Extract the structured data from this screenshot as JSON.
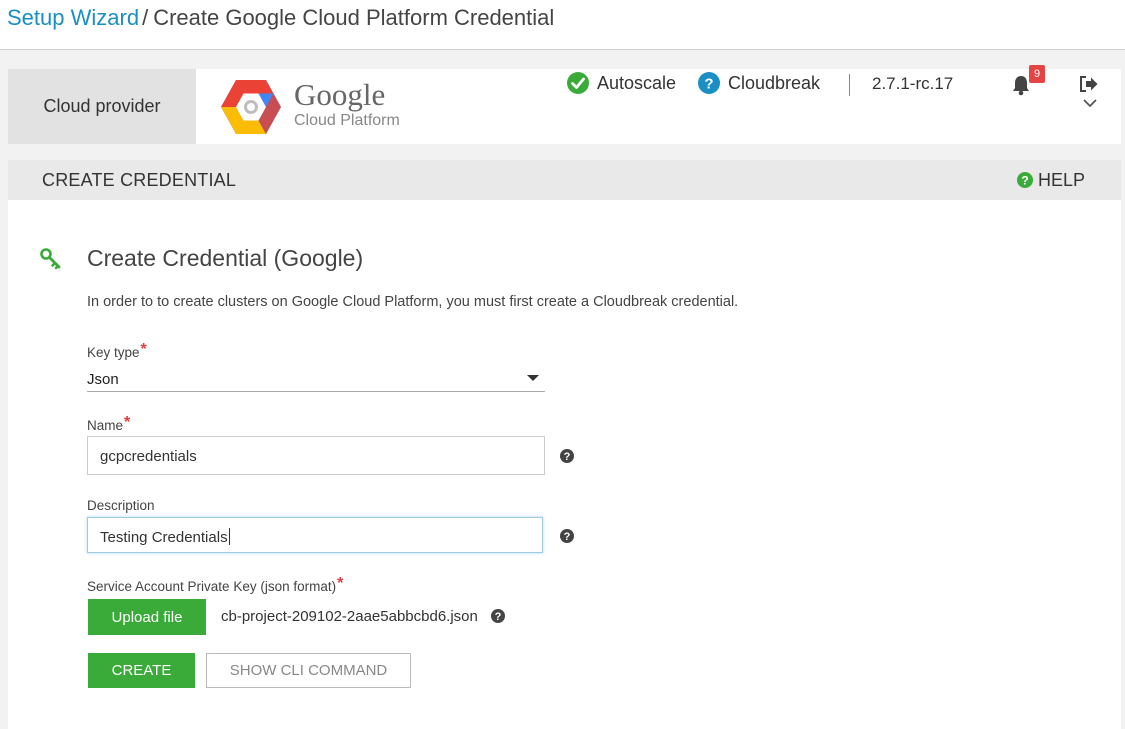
{
  "breadcrumb": {
    "parent": "Setup Wizard",
    "separator": "/",
    "current": "Create Google Cloud Platform Credential"
  },
  "provider_bar": {
    "label": "Cloud provider",
    "logo_title": "Google",
    "logo_subtitle": "Cloud Platform"
  },
  "header_status": {
    "autoscale": "Autoscale",
    "cloudbreak": "Cloudbreak",
    "version": "2.7.1-rc.17",
    "notification_count": "9"
  },
  "panel": {
    "title": "CREATE CREDENTIAL",
    "help": "HELP"
  },
  "form": {
    "title": "Create Credential (Google)",
    "intro": "In order to to create clusters on Google Cloud Platform, you must first create a Cloudbreak credential.",
    "key_type_label": "Key type",
    "key_type_value": "Json",
    "name_label": "Name",
    "name_value": "gcpcredentials",
    "description_label": "Description",
    "description_value": "Testing Credentials",
    "private_key_label": "Service Account Private Key (json format)",
    "upload_button": "Upload file",
    "file_name": "cb-project-209102-2aae5abbcbd6.json",
    "required_marker": "*"
  },
  "actions": {
    "create": "CREATE",
    "show_cli": "SHOW CLI COMMAND"
  },
  "colors": {
    "link": "#1a8fc4",
    "primary_green": "#3aab39",
    "required_red": "#e83b3b",
    "badge_red": "#e44444",
    "help_blue": "#1a8fc4"
  },
  "icons": [
    "check-circle-icon",
    "question-circle-icon",
    "bell-icon",
    "logout-icon",
    "chevron-down-icon",
    "key-icon",
    "help-circle-icon",
    "gcp-logo"
  ]
}
